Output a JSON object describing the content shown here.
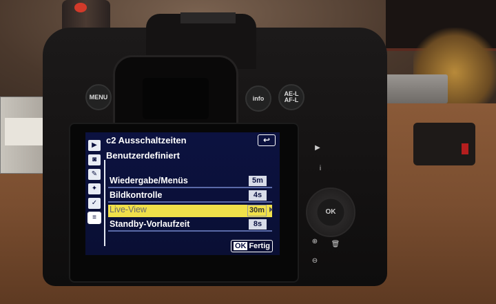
{
  "camera": {
    "buttons": {
      "menu": "MENU",
      "info": "info",
      "ae_l_af_l": "AE-L AF-L",
      "ok": "OK",
      "info_i": "i"
    }
  },
  "lcd": {
    "menu_code": "c2",
    "title": "Ausschaltzeiten",
    "back_glyph": "↩",
    "subtitle": "Benutzerdefiniert",
    "sidebar_icons": [
      "playback-icon",
      "camera-icon",
      "pencil-icon",
      "wrench-icon",
      "retouch-icon",
      "mymenu-icon"
    ],
    "rows": [
      {
        "label": "Wiedergabe/Menüs",
        "value": "5m",
        "selected": false
      },
      {
        "label": "Bildkontrolle",
        "value": "4s",
        "selected": false
      },
      {
        "label": "Live-View",
        "value": "30m",
        "selected": true
      },
      {
        "label": "Standby-Vorlaufzeit",
        "value": "8s",
        "selected": false
      }
    ],
    "ok_label": "OK",
    "done_label": "Fertig"
  }
}
